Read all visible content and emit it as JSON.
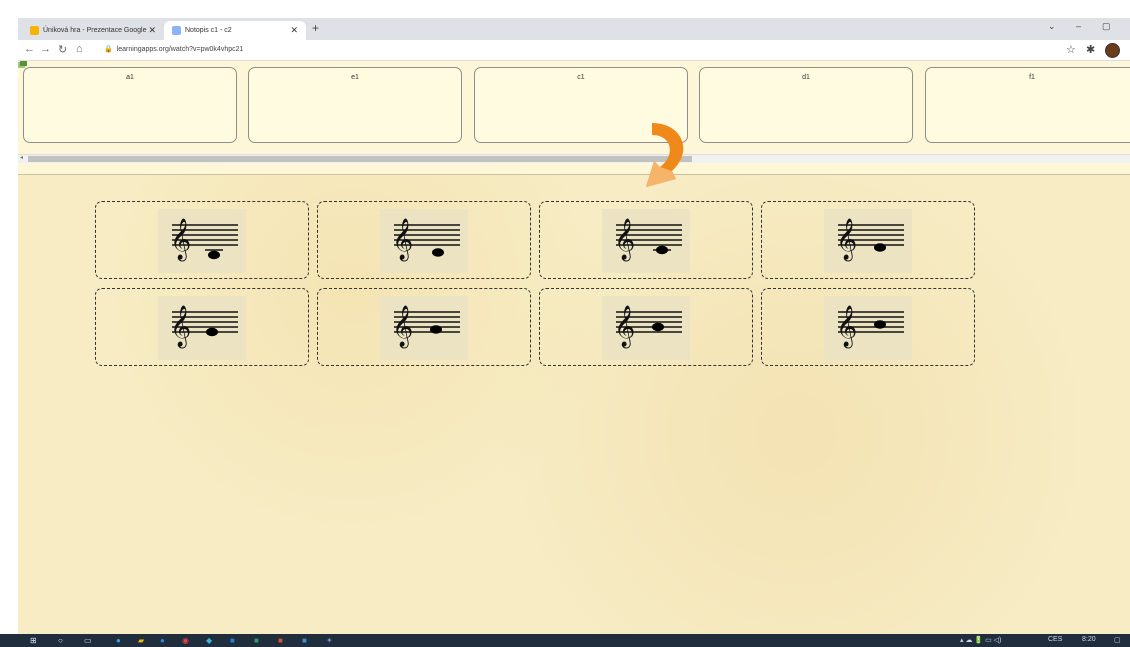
{
  "browser": {
    "tabs": [
      {
        "label": "Úniková hra - Prezentace Google",
        "icon": "slides-icon",
        "color": "#f4b400"
      },
      {
        "label": "Notopis c1 - c2",
        "icon": "learningapps-icon",
        "color": "#8ab4f8"
      }
    ],
    "url": "learningapps.org/watch?v=pw0k4vhpc21"
  },
  "app": {
    "targets": [
      {
        "label": "a1"
      },
      {
        "label": "e1"
      },
      {
        "label": "c1"
      },
      {
        "label": "d1"
      },
      {
        "label": "f1"
      }
    ],
    "cards": [
      {
        "note": "c1"
      },
      {
        "note": "d1"
      },
      {
        "note": "e1"
      },
      {
        "note": "f1"
      },
      {
        "note": "g1"
      },
      {
        "note": "a1"
      },
      {
        "note": "h1"
      },
      {
        "note": "c2"
      }
    ],
    "arrow_color": "#ef8a1a"
  },
  "taskbar": {
    "clock": "8:20",
    "lang": "CES"
  }
}
